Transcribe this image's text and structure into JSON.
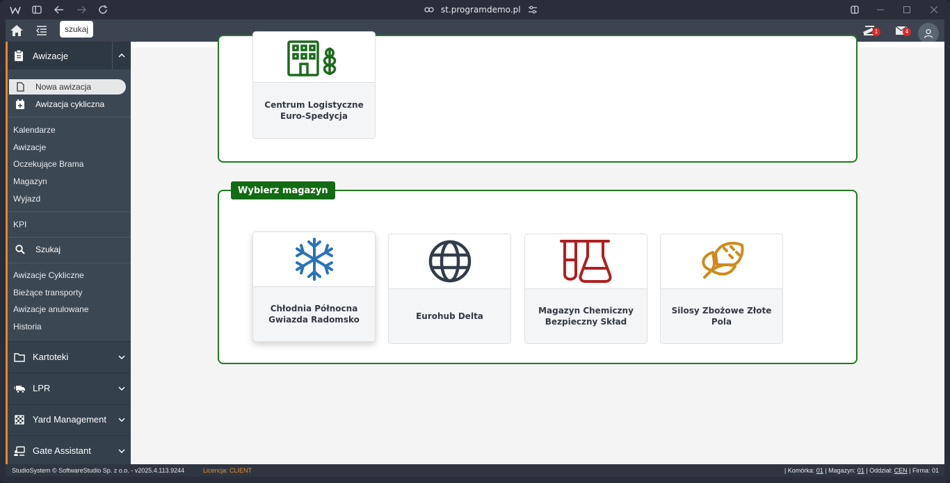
{
  "browser": {
    "url": "st.programdemo.pl"
  },
  "topbar": {
    "search_label": "szukaj",
    "notifications": [
      {
        "icon": "truck-alert-icon",
        "count": "1"
      },
      {
        "icon": "mail-icon",
        "count": "4"
      }
    ]
  },
  "sidebar": {
    "section": "Awizacje",
    "subitems": [
      {
        "label": "Nowa awizacja",
        "icon": "file-icon",
        "active": true
      },
      {
        "label": "Awizacja cykliczna",
        "icon": "calendar-plus-icon",
        "active": false
      }
    ],
    "links_a": [
      "Kalendarze",
      "Awizacje",
      "Oczekujące Brama",
      "Magazyn",
      "Wyjazd"
    ],
    "links_b": [
      "KPI"
    ],
    "search_label": "Szukaj",
    "links_c": [
      "Awizacje Cykliczne",
      "Bieżące transporty",
      "Awizacje anulowane",
      "Historia"
    ],
    "groups": [
      {
        "label": "Kartoteki",
        "icon": "folder-icon"
      },
      {
        "label": "LPR",
        "icon": "truck-fast-icon"
      },
      {
        "label": "Yard Management",
        "icon": "checkerboard-icon"
      },
      {
        "label": "Gate Assistant",
        "icon": "gate-assistant-icon"
      }
    ]
  },
  "main": {
    "upper_card": {
      "name": "Centrum Logistyczne Euro-Spedycja",
      "icon": "building-wheat-icon",
      "color": "#1b6b1b"
    },
    "panel_title": "Wybierz magazyn",
    "cards": [
      {
        "name": "Chłodnia Północna Gwiazda Radomsko",
        "icon": "snowflake-icon",
        "color": "#2a73b8"
      },
      {
        "name": "Eurohub Delta",
        "icon": "globe-icon",
        "color": "#333d49"
      },
      {
        "name": "Magazyn Chemiczny Bezpieczny Skład",
        "icon": "flask-icon",
        "color": "#b01f1f"
      },
      {
        "name": "Silosy Zbożowe Złote Pola",
        "icon": "corn-icon",
        "color": "#d08a1a"
      }
    ]
  },
  "footer": {
    "copyright": "StudioSystem © SoftwareStudio Sp. z o.o. - v2025.4.113.9244",
    "license": "Licencja: CLIENT",
    "komorka_label": "| Komórka:",
    "komorka": "01",
    "magazyn_label": "| Magazyn:",
    "magazyn": "01",
    "oddzial_label": "| Oddział:",
    "oddzial": "CEN",
    "firma_label": "| Firma: 01"
  },
  "colors": {
    "accent_green": "#136b13",
    "accent_orange": "#e5892b",
    "sidebar": "#3b4753"
  }
}
